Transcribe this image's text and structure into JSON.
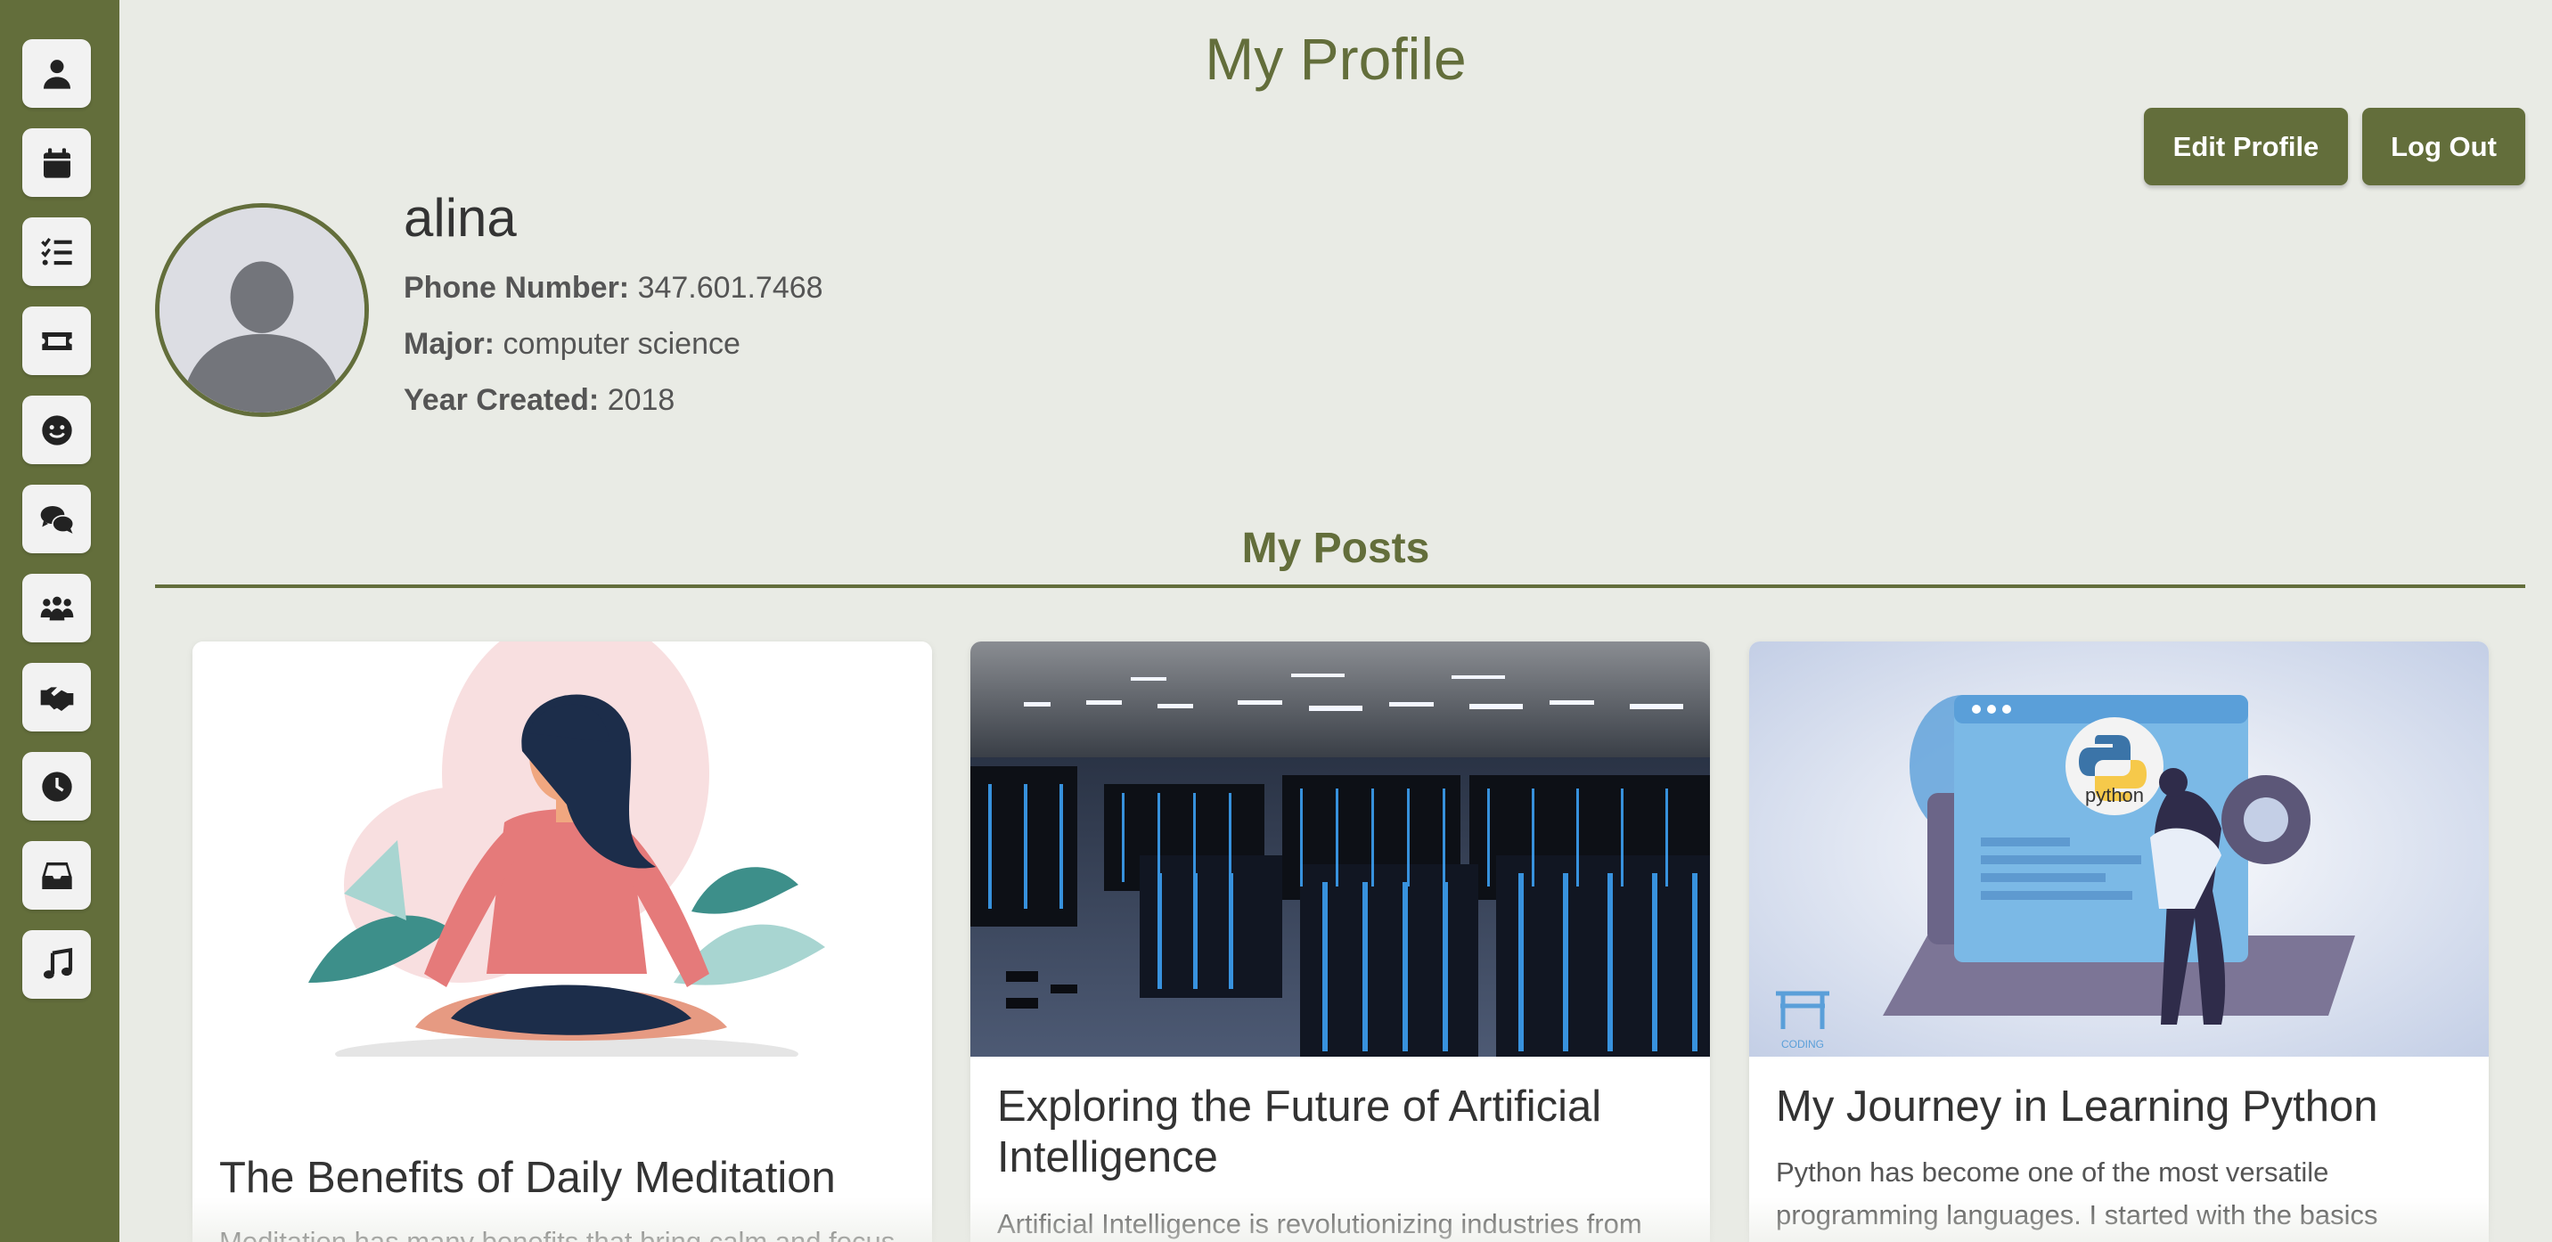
{
  "header": {
    "title": "My Profile"
  },
  "actions": {
    "edit_label": "Edit Profile",
    "logout_label": "Log Out"
  },
  "sidebar": {
    "items": [
      {
        "icon": "user-icon"
      },
      {
        "icon": "calendar-icon"
      },
      {
        "icon": "task-list-icon"
      },
      {
        "icon": "ticket-icon"
      },
      {
        "icon": "smiley-icon"
      },
      {
        "icon": "chat-icon"
      },
      {
        "icon": "people-group-icon"
      },
      {
        "icon": "handshake-icon"
      },
      {
        "icon": "clock-icon"
      },
      {
        "icon": "inbox-icon"
      },
      {
        "icon": "music-icon"
      }
    ]
  },
  "profile": {
    "username": "alina",
    "phone_label": "Phone Number:",
    "phone": "347.601.7468",
    "major_label": "Major:",
    "major": "computer science",
    "year_label": "Year Created:",
    "year": "2018"
  },
  "posts": {
    "heading": "My Posts",
    "items": [
      {
        "title": "The Benefits of Daily Meditation",
        "excerpt": "Meditation has many benefits that bring calm and focus"
      },
      {
        "title": "Exploring the Future of Artificial Intelligence",
        "excerpt": "Artificial Intelligence is revolutionizing industries from"
      },
      {
        "title": "My Journey in Learning Python",
        "excerpt": "Python has become one of the most versatile programming languages. I started with the basics"
      }
    ],
    "python_logo_text": "python",
    "coding_watermark": "CODING"
  },
  "colors": {
    "accent": "#636e3b",
    "background": "#e9ebe5",
    "button_text": "#ffffff"
  }
}
